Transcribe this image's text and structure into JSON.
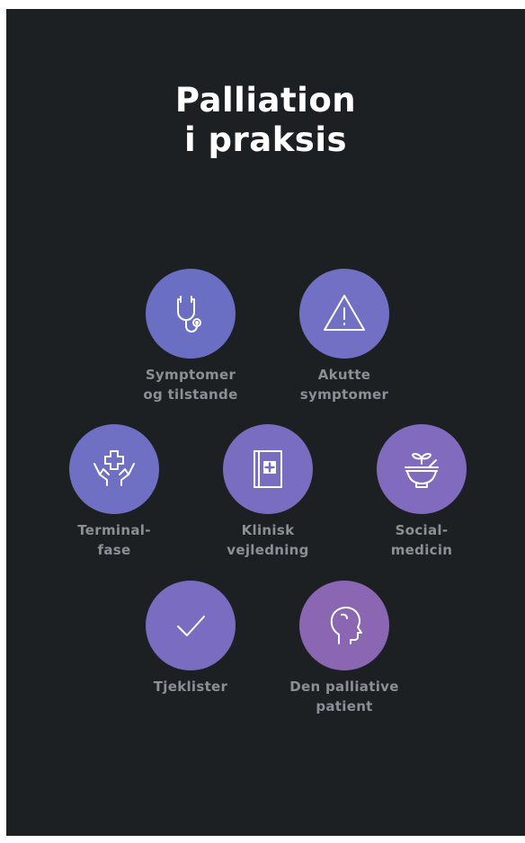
{
  "title": {
    "line1": "Palliation",
    "line2": "i praksis"
  },
  "colors": {
    "background": "#1d2023",
    "circle_indigo": "#6a6fc4",
    "circle_violet": "#7f6bbf",
    "circle_purple": "#8a66b3",
    "label": "#8b8f96"
  },
  "items": [
    {
      "icon": "stethoscope-icon",
      "line1": "Symptomer",
      "line2": "og tilstande"
    },
    {
      "icon": "warning-triangle-icon",
      "line1": "Akutte",
      "line2": "symptomer"
    },
    {
      "icon": "hands-cross-icon",
      "line1": "Terminal-",
      "line2": "fase"
    },
    {
      "icon": "medical-book-icon",
      "line1": "Klinisk",
      "line2": "vejledning"
    },
    {
      "icon": "bowl-sprout-icon",
      "line1": "Social-",
      "line2": "medicin"
    },
    {
      "icon": "checkmark-icon",
      "line1": "Tjeklister",
      "line2": ""
    },
    {
      "icon": "head-profile-icon",
      "line1": "Den palliative",
      "line2": "patient"
    }
  ]
}
